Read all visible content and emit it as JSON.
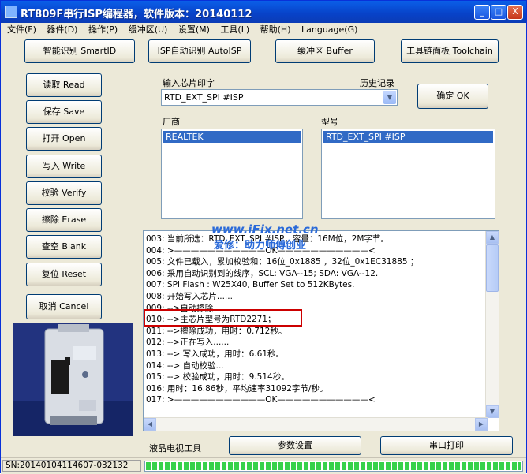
{
  "window": {
    "title": "RT809F串行ISP编程器，软件版本：20140112",
    "minimize": "_",
    "maximize": "□",
    "close": "X"
  },
  "menu": [
    "文件(F)",
    "器件(D)",
    "操作(P)",
    "缓冲区(U)",
    "设置(M)",
    "工具(L)",
    "帮助(H)",
    "Language(G)"
  ],
  "toolbar": {
    "auto_id": "智能识别 SmartID",
    "isp_auto": "ISP自动识别 AutoISP",
    "buffer": "缓冲区 Buffer",
    "toolchain": "工具链面板 Toolchain"
  },
  "side_buttons": {
    "read": "读取 Read",
    "save": "保存 Save",
    "open": "打开 Open",
    "write": "写入 Write",
    "verify": "校验 Verify",
    "erase": "擦除 Erase",
    "blank": "查空 Blank",
    "reset": "复位 Reset",
    "cancel": "取消 Cancel"
  },
  "chip": {
    "input_label": "输入芯片印字",
    "history_label": "历史记录",
    "value": "RTD_EXT_SPI #ISP",
    "confirm": "确定 OK",
    "vendor_label": "厂商",
    "model_label": "型号",
    "vendor_selected": "REALTEK",
    "model_selected": "RTD_EXT_SPI #ISP"
  },
  "watermark": {
    "site": "www.iFix.net.cn",
    "slogan": "爱修：助力师傅创业"
  },
  "log": [
    "003: 当前所选：RTD_EXT_SPI #ISP，容量：16M位，2M字节。",
    "004: >———————————OK———————————<",
    "005: 文件已载入，累加校验和：16位_0x1885 ，32位_0x1EC31885 ；",
    "006: 采用自动识别到的线序，SCL: VGA--15; SDA: VGA--12.",
    "007: SPI Flash : W25X40, Buffer Set to 512KBytes.",
    "008: 开始写入芯片......",
    "009: -->自动擦除......",
    "010: -->主芯片型号为RTD2271；",
    "011: -->擦除成功，用时：0.712秒。",
    "012: -->正在写入......",
    "013: --> 写入成功，用时：6.61秒。",
    "014: --> 自动校验...",
    "015: --> 校验成功，用时：9.514秒。",
    "016: 用时：16.86秒，平均速率31092字节/秒。",
    "017: >———————————OK———————————<"
  ],
  "bottom": {
    "lcd_tools": "液晶电视工具",
    "params": "参数设置",
    "serial_print": "串口打印"
  },
  "status": {
    "sn": "SN:20140104114607-032132",
    "progress": 1.0,
    "progress_color": "#37d14a"
  }
}
